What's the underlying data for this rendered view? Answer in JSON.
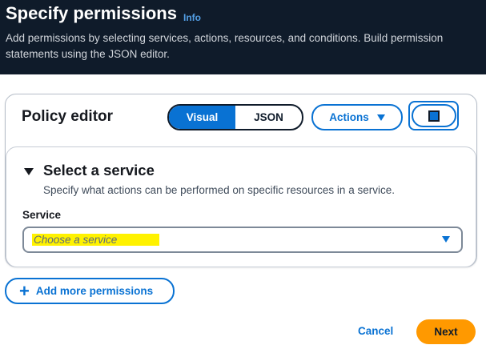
{
  "header": {
    "title": "Specify permissions",
    "info_link": "Info",
    "description": "Add permissions by selecting services, actions, resources, and conditions. Build permission statements using the JSON editor."
  },
  "policy_editor": {
    "title": "Policy editor",
    "modes": [
      {
        "label": "Visual",
        "selected": true
      },
      {
        "label": "JSON",
        "selected": false
      }
    ],
    "actions_label": "Actions",
    "square_button_icon": "stop-square-icon"
  },
  "service_section": {
    "title": "Select a service",
    "description": "Specify what actions can be performed on specific resources in a service.",
    "field_label": "Service",
    "select_placeholder": "Choose a service",
    "highlight_color": "#fff200"
  },
  "footer": {
    "add_more_label": "Add more permissions",
    "cancel_label": "Cancel",
    "next_label": "Next"
  },
  "colors": {
    "header_bg": "#0f1b2a",
    "accent": "#0972d3",
    "primary_button": "#ff9900"
  }
}
